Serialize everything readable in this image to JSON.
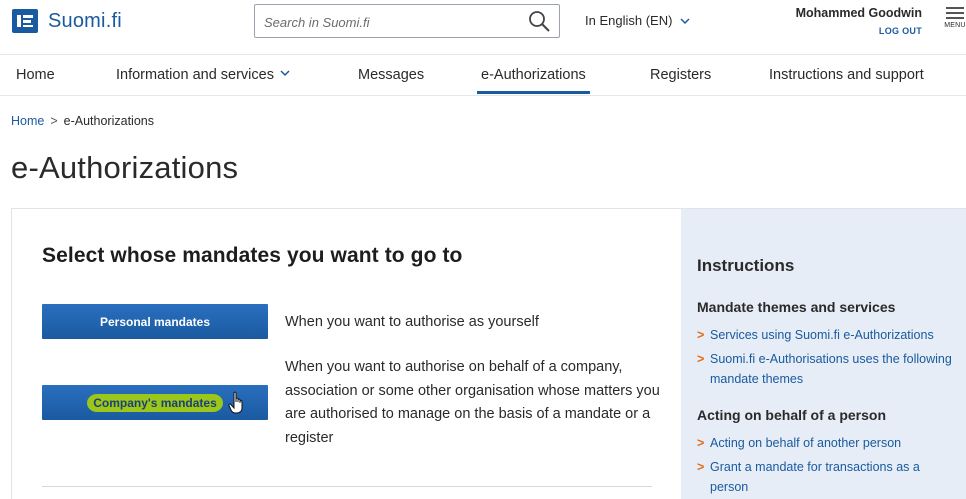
{
  "header": {
    "logo_text": "Suomi.fi",
    "search": {
      "placeholder": "Search in Suomi.fi"
    },
    "language": "In English (EN)",
    "user_name": "Mohammed Goodwin",
    "logout_label": "LOG OUT",
    "menu_label": "MENU"
  },
  "nav": {
    "items": [
      {
        "label": "Home"
      },
      {
        "label": "Information and services"
      },
      {
        "label": "Messages"
      },
      {
        "label": "e-Authorizations"
      },
      {
        "label": "Registers"
      },
      {
        "label": "Instructions and support"
      }
    ],
    "active": "e-Authorizations"
  },
  "breadcrumb": {
    "home": "Home",
    "separator": ">",
    "current": "e-Authorizations"
  },
  "page_title": "e-Authorizations",
  "main": {
    "heading": "Select whose mandates you want to go to",
    "personal_button": "Personal mandates",
    "personal_desc": "When you want to authorise as yourself",
    "company_button": "Company's mandates",
    "company_desc": "When you want to authorise on behalf of a company, association or some other organisation whose matters you are authorised to manage on the basis of a mandate or a register"
  },
  "sidebar": {
    "title": "Instructions",
    "section1": {
      "title": "Mandate themes and services",
      "links": [
        "Services using Suomi.fi e-Authorizations",
        "Suomi.fi e-Authorisations uses the following mandate themes"
      ]
    },
    "section2": {
      "title": "Acting on behalf of a person",
      "links": [
        "Acting on behalf of another person",
        "Grant a mandate for transactions as a person"
      ]
    },
    "link_arrow": ">"
  },
  "colors": {
    "brand_blue": "#1a5aa0",
    "sidebar_bg": "#e6edf6",
    "highlight": "#9bc71a",
    "link_arrow": "#e06c1b"
  }
}
